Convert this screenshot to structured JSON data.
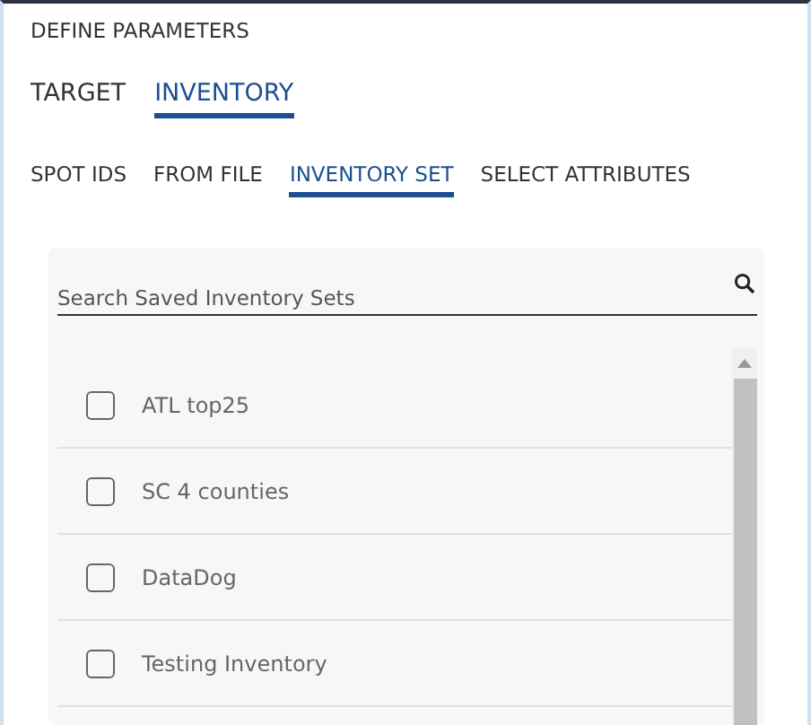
{
  "heading": "DEFINE PARAMETERS",
  "tabs": [
    {
      "label": "TARGET",
      "selected": false
    },
    {
      "label": "INVENTORY",
      "selected": true
    }
  ],
  "subtabs": [
    {
      "label": "SPOT IDS",
      "selected": false
    },
    {
      "label": "FROM FILE",
      "selected": false
    },
    {
      "label": "INVENTORY SET",
      "selected": true
    },
    {
      "label": "SELECT ATTRIBUTES",
      "selected": false
    }
  ],
  "search": {
    "placeholder": "Search Saved Inventory Sets"
  },
  "items": [
    {
      "label": "ATL top25",
      "checked": false
    },
    {
      "label": "SC 4 counties",
      "checked": false
    },
    {
      "label": "DataDog",
      "checked": false
    },
    {
      "label": "Testing Inventory",
      "checked": false
    }
  ]
}
